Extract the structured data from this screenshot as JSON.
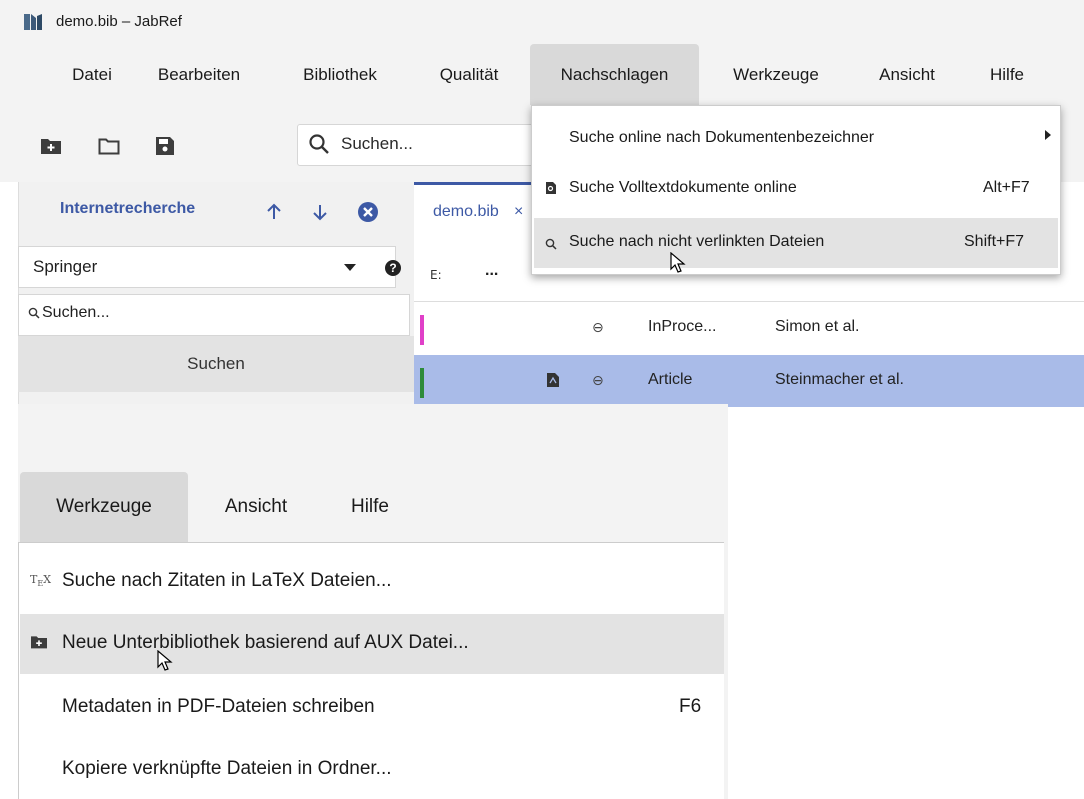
{
  "window": {
    "title": "demo.bib – JabRef"
  },
  "menubar": {
    "items": [
      "Datei",
      "Bearbeiten",
      "Bibliothek",
      "Qualität",
      "Nachschlagen",
      "Werkzeuge",
      "Ansicht",
      "Hilfe"
    ],
    "active": "Nachschlagen"
  },
  "toolbar": {
    "icons": [
      "new-library-icon",
      "open-folder-icon",
      "save-icon"
    ],
    "search_placeholder": "Suchen..."
  },
  "web_search": {
    "title": "Internetrecherche",
    "provider": "Springer",
    "query_placeholder": "Suchen...",
    "search_button": "Suchen"
  },
  "library": {
    "tab_label": "demo.bib",
    "tab_close": "×",
    "header_more": "...",
    "rows": [
      {
        "type": "InProce...",
        "author": "Simon et al.",
        "color": "#e040c8",
        "has_pdf": false,
        "selected": false
      },
      {
        "type": "Article",
        "author": "Steinmacher et al.",
        "color": "#2e8b3a",
        "has_pdf": true,
        "selected": true
      }
    ]
  },
  "lookup_menu": {
    "items": [
      {
        "label": "Suche online nach Dokumentenbezeichner",
        "accel": "",
        "has_submenu": true,
        "icon": ""
      },
      {
        "label": "Suche Volltextdokumente online",
        "accel": "Alt+F7",
        "has_submenu": false,
        "icon": "document-search-icon"
      },
      {
        "label": "Suche nach nicht verlinkten Dateien",
        "accel": "Shift+F7",
        "has_submenu": false,
        "icon": "search-icon",
        "highlighted": true
      }
    ]
  },
  "panel2": {
    "menubar": {
      "items": [
        "Werkzeuge",
        "Ansicht",
        "Hilfe"
      ],
      "active": "Werkzeuge"
    },
    "tools_menu": {
      "items": [
        {
          "label": "Suche nach Zitaten in LaTeX Dateien...",
          "accel": "",
          "icon": "tex-icon"
        },
        {
          "label": "Neue Unterbibliothek basierend auf AUX Datei...",
          "accel": "",
          "icon": "new-library-icon",
          "highlighted": true
        },
        {
          "label": "Metadaten in PDF-Dateien schreiben",
          "accel": "F6",
          "icon": ""
        },
        {
          "label": "Kopiere verknüpfte Dateien in Ordner...",
          "accel": "",
          "icon": ""
        }
      ]
    }
  },
  "colors": {
    "accent": "#3d59a5",
    "selection": "#a9bbe8",
    "menu_highlight": "#e3e3e3"
  }
}
